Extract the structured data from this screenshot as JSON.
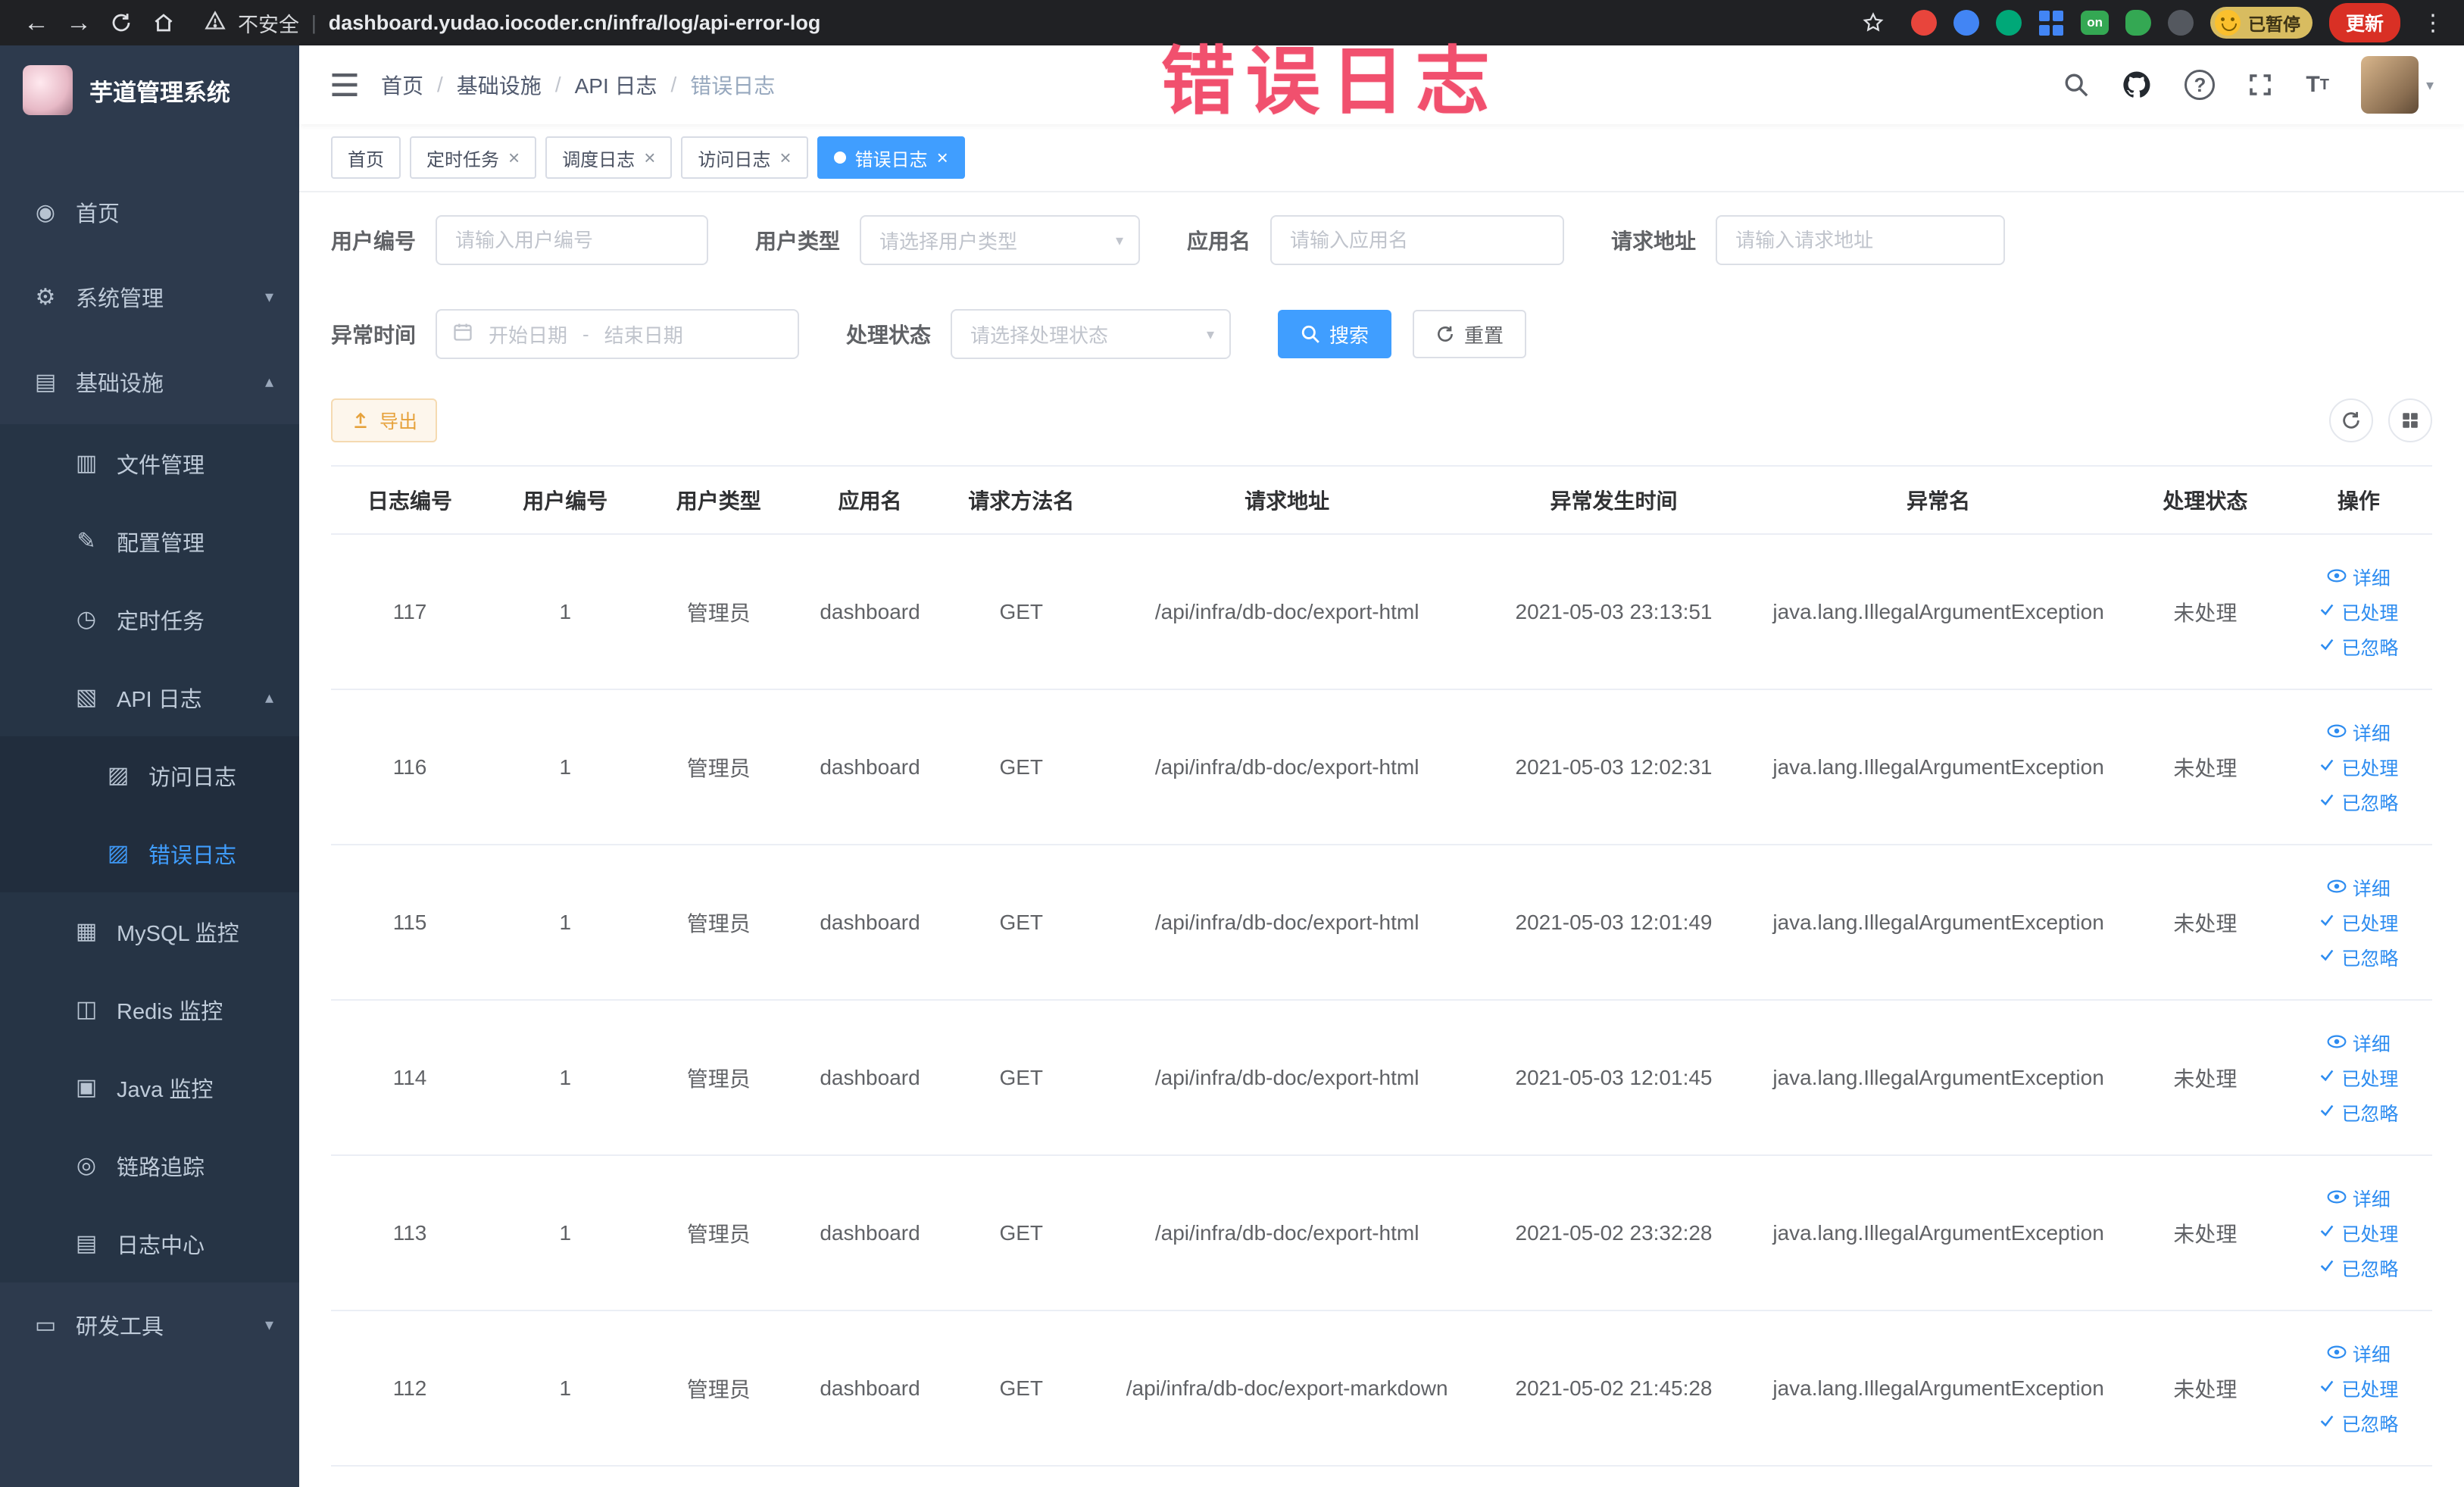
{
  "browser": {
    "security_label": "不安全",
    "url": "dashboard.yudao.iocoder.cn/infra/log/api-error-log",
    "on_badge": "on",
    "paused_badge": "已暂停",
    "update_button": "更新"
  },
  "sidebar": {
    "logo_title": "芋道管理系统",
    "items": [
      {
        "label": "首页"
      },
      {
        "label": "系统管理"
      },
      {
        "label": "基础设施"
      },
      {
        "label": "文件管理"
      },
      {
        "label": "配置管理"
      },
      {
        "label": "定时任务"
      },
      {
        "label": "API 日志"
      },
      {
        "label": "访问日志"
      },
      {
        "label": "错误日志"
      },
      {
        "label": "MySQL 监控"
      },
      {
        "label": "Redis 监控"
      },
      {
        "label": "Java 监控"
      },
      {
        "label": "链路追踪"
      },
      {
        "label": "日志中心"
      },
      {
        "label": "研发工具"
      }
    ]
  },
  "header": {
    "breadcrumb": [
      "首页",
      "基础设施",
      "API 日志",
      "错误日志"
    ],
    "annotation": "错误日志"
  },
  "tabs": [
    {
      "label": "首页"
    },
    {
      "label": "定时任务"
    },
    {
      "label": "调度日志"
    },
    {
      "label": "访问日志"
    },
    {
      "label": "错误日志"
    }
  ],
  "filters": {
    "user_id_label": "用户编号",
    "user_id_placeholder": "请输入用户编号",
    "user_type_label": "用户类型",
    "user_type_placeholder": "请选择用户类型",
    "app_name_label": "应用名",
    "app_name_placeholder": "请输入应用名",
    "request_url_label": "请求地址",
    "request_url_placeholder": "请输入请求地址",
    "exception_time_label": "异常时间",
    "start_date_placeholder": "开始日期",
    "range_separator": "-",
    "end_date_placeholder": "结束日期",
    "process_status_label": "处理状态",
    "process_status_placeholder": "请选择处理状态",
    "search_button": "搜索",
    "reset_button": "重置"
  },
  "toolbar": {
    "export_button": "导出"
  },
  "table": {
    "columns": [
      "日志编号",
      "用户编号",
      "用户类型",
      "应用名",
      "请求方法名",
      "请求地址",
      "异常发生时间",
      "异常名",
      "处理状态",
      "操作"
    ],
    "actions": [
      "详细",
      "已处理",
      "已忽略"
    ],
    "rows": [
      {
        "log_id": "117",
        "user_id": "1",
        "user_type": "管理员",
        "app_name": "dashboard",
        "method": "GET",
        "url": "/api/infra/db-doc/export-html",
        "time": "2021-05-03 23:13:51",
        "exception": "java.lang.IllegalArgumentException",
        "status": "未处理"
      },
      {
        "log_id": "116",
        "user_id": "1",
        "user_type": "管理员",
        "app_name": "dashboard",
        "method": "GET",
        "url": "/api/infra/db-doc/export-html",
        "time": "2021-05-03 12:02:31",
        "exception": "java.lang.IllegalArgumentException",
        "status": "未处理"
      },
      {
        "log_id": "115",
        "user_id": "1",
        "user_type": "管理员",
        "app_name": "dashboard",
        "method": "GET",
        "url": "/api/infra/db-doc/export-html",
        "time": "2021-05-03 12:01:49",
        "exception": "java.lang.IllegalArgumentException",
        "status": "未处理"
      },
      {
        "log_id": "114",
        "user_id": "1",
        "user_type": "管理员",
        "app_name": "dashboard",
        "method": "GET",
        "url": "/api/infra/db-doc/export-html",
        "time": "2021-05-03 12:01:45",
        "exception": "java.lang.IllegalArgumentException",
        "status": "未处理"
      },
      {
        "log_id": "113",
        "user_id": "1",
        "user_type": "管理员",
        "app_name": "dashboard",
        "method": "GET",
        "url": "/api/infra/db-doc/export-html",
        "time": "2021-05-02 23:32:28",
        "exception": "java.lang.IllegalArgumentException",
        "status": "未处理"
      },
      {
        "log_id": "112",
        "user_id": "1",
        "user_type": "管理员",
        "app_name": "dashboard",
        "method": "GET",
        "url": "/api/infra/db-doc/export-markdown",
        "time": "2021-05-02 21:45:28",
        "exception": "java.lang.IllegalArgumentException",
        "status": "未处理"
      }
    ]
  },
  "colors": {
    "accent_blue": "#409eff",
    "link_blue": "#2d8cf0",
    "warning_orange": "#e6a23c",
    "annotation_pink": "#f1506e",
    "sidebar_bg": "#2d3a4d"
  }
}
